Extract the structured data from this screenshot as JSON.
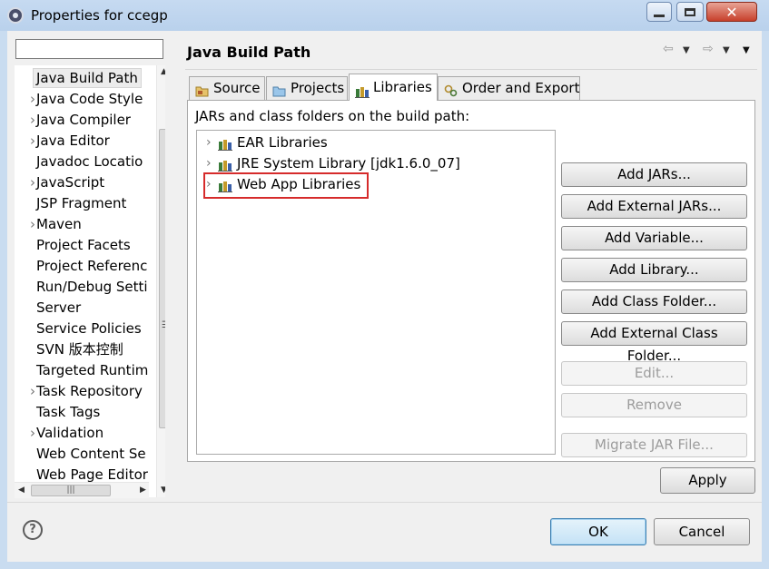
{
  "window": {
    "title": "Properties for ccegp"
  },
  "filter": {
    "placeholder": "",
    "value": ""
  },
  "nav": {
    "items": [
      {
        "label": "Java Build Path",
        "expandable": false,
        "selected": true
      },
      {
        "label": "Java Code Style",
        "expandable": true
      },
      {
        "label": "Java Compiler",
        "expandable": true
      },
      {
        "label": "Java Editor",
        "expandable": true
      },
      {
        "label": "Javadoc Locatio",
        "expandable": false
      },
      {
        "label": "JavaScript",
        "expandable": true
      },
      {
        "label": "JSP Fragment",
        "expandable": false
      },
      {
        "label": "Maven",
        "expandable": true
      },
      {
        "label": "Project Facets",
        "expandable": false
      },
      {
        "label": "Project Referenc",
        "expandable": false
      },
      {
        "label": "Run/Debug Setti",
        "expandable": false
      },
      {
        "label": "Server",
        "expandable": false
      },
      {
        "label": "Service Policies",
        "expandable": false
      },
      {
        "label": "SVN 版本控制",
        "expandable": false
      },
      {
        "label": "Targeted Runtim",
        "expandable": false
      },
      {
        "label": "Task Repository",
        "expandable": true
      },
      {
        "label": "Task Tags",
        "expandable": false
      },
      {
        "label": "Validation",
        "expandable": true
      },
      {
        "label": "Web Content Se",
        "expandable": false
      },
      {
        "label": "Web Page Editor",
        "expandable": false
      }
    ]
  },
  "page": {
    "title": "Java Build Path"
  },
  "tabs": [
    {
      "label": "Source",
      "icon": "source-folder-icon",
      "active": false
    },
    {
      "label": "Projects",
      "icon": "projects-folder-icon",
      "active": false
    },
    {
      "label": "Libraries",
      "icon": "libraries-icon",
      "active": true
    },
    {
      "label": "Order and Export",
      "icon": "order-export-icon",
      "active": false
    }
  ],
  "libraries": {
    "label": "JARs and class folders on the build path:",
    "items": [
      {
        "label": "EAR Libraries",
        "highlighted": false
      },
      {
        "label": "JRE System Library [jdk1.6.0_07]",
        "highlighted": false
      },
      {
        "label": "Web App Libraries",
        "highlighted": true
      }
    ]
  },
  "buttons": [
    {
      "label": "Add JARs...",
      "enabled": true
    },
    {
      "label": "Add External JARs...",
      "enabled": true
    },
    {
      "label": "Add Variable...",
      "enabled": true
    },
    {
      "label": "Add Library...",
      "enabled": true
    },
    {
      "label": "Add Class Folder...",
      "enabled": true
    },
    {
      "label": "Add External Class Folder...",
      "enabled": true
    },
    {
      "label": "Edit...",
      "enabled": false
    },
    {
      "label": "Remove",
      "enabled": false
    },
    {
      "label": "Migrate JAR File...",
      "enabled": false
    }
  ],
  "actions": {
    "apply": "Apply",
    "ok": "OK",
    "cancel": "Cancel",
    "help": "?"
  },
  "colors": {
    "highlight_border": "#d62b2b",
    "window_frame": "#c9dcf0"
  }
}
